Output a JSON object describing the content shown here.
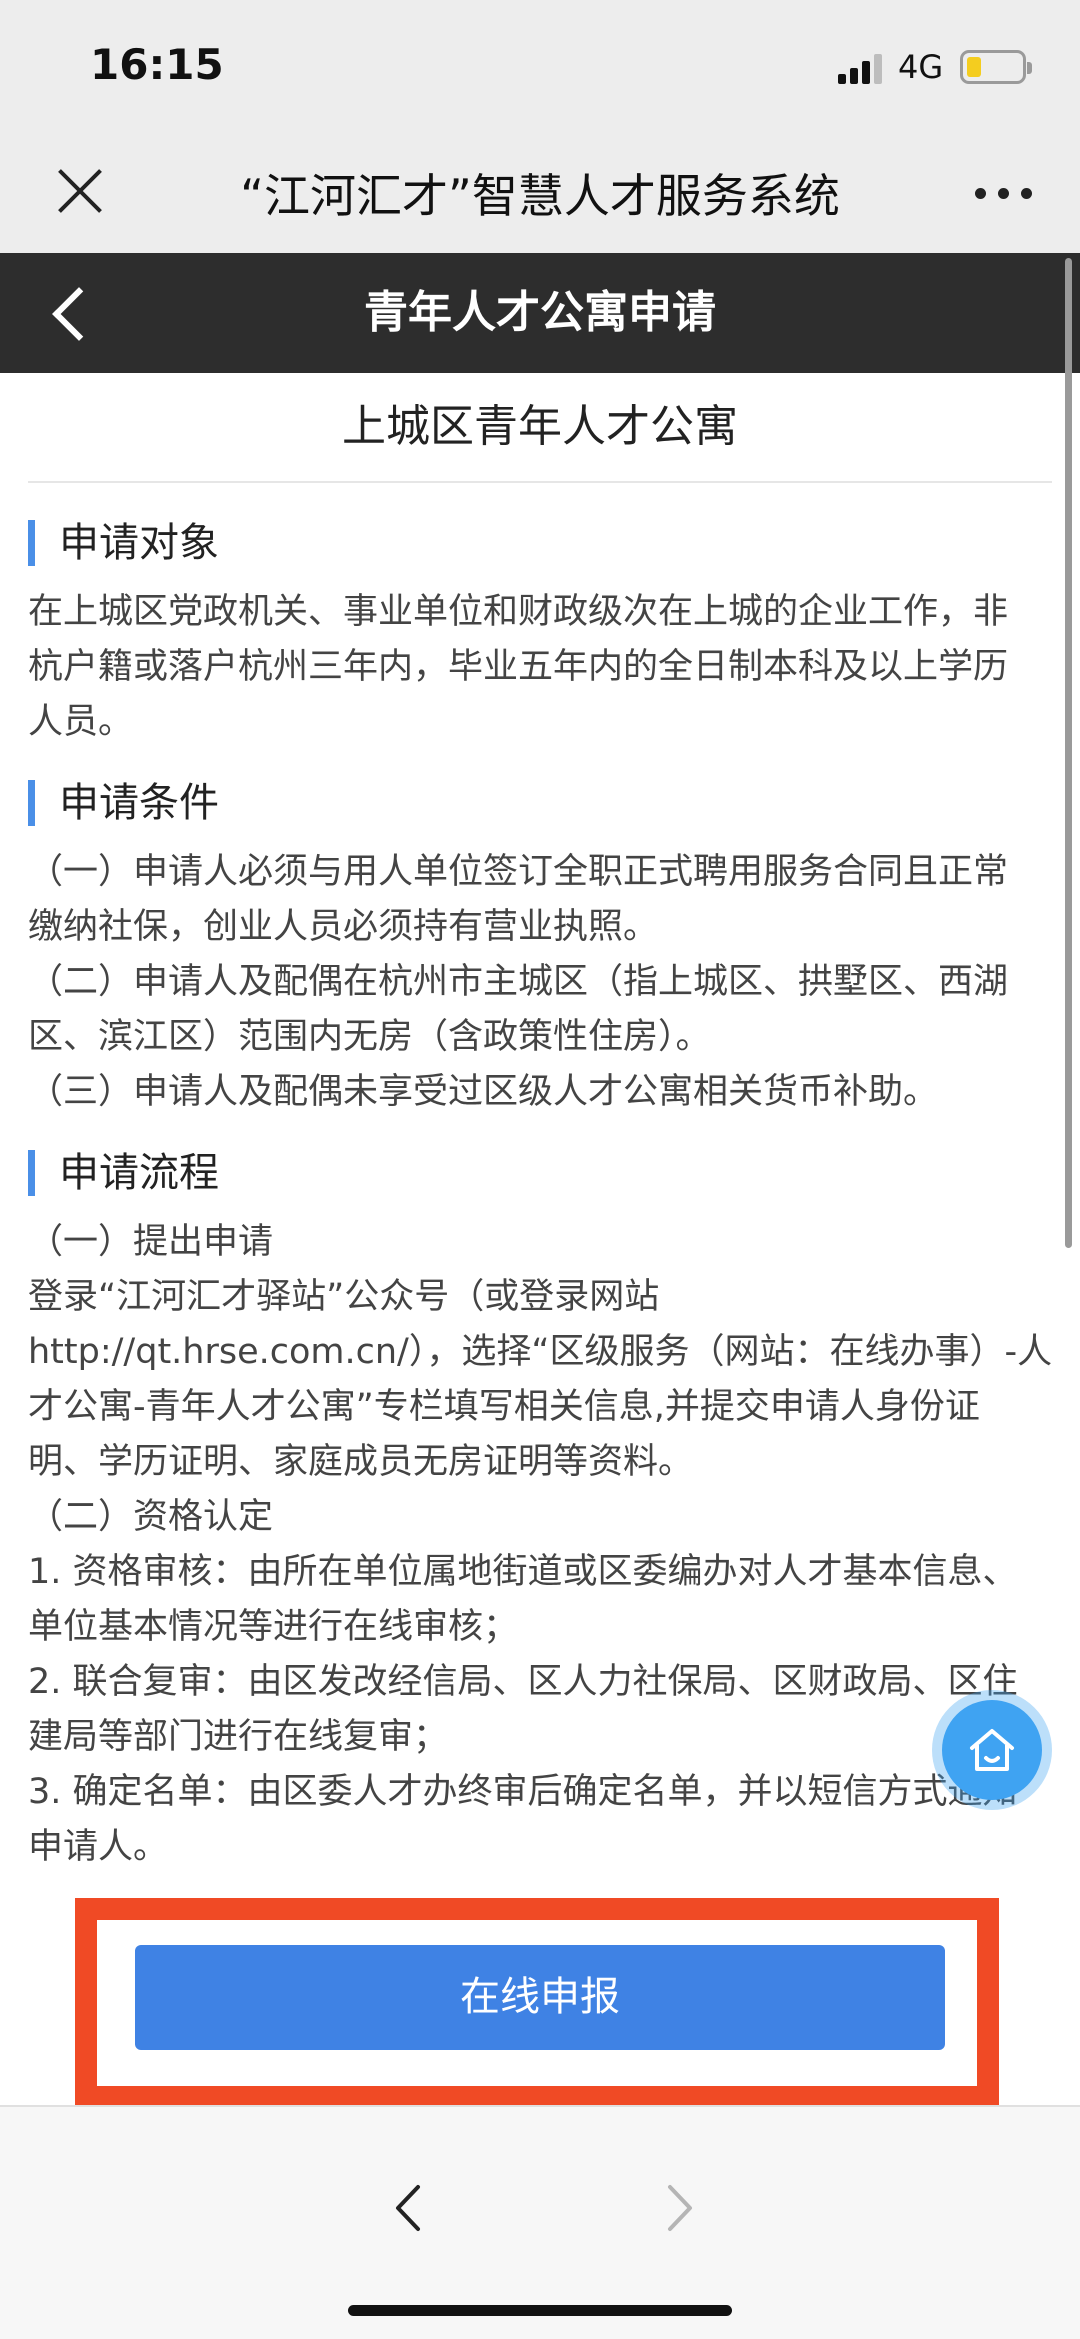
{
  "status": {
    "time": "16:15",
    "network": "4G"
  },
  "header": {
    "title": "“江河汇才”智慧人才服务系统"
  },
  "nav": {
    "title": "青年人才公寓申请"
  },
  "content": {
    "apartment_title": "上城区青年人才公寓",
    "sections": [
      {
        "heading": "申请对象",
        "lines": [
          "在上城区党政机关、事业单位和财政级次在上城的企业工作，非",
          "杭户籍或落户杭州三年内，毕业五年内的全日制本科及以上学历",
          "人员。"
        ]
      },
      {
        "heading": "申请条件",
        "lines": [
          "（一）申请人必须与用人单位签订全职正式聘用服务合同且正常",
          "缴纳社保，创业人员必须持有营业执照。",
          "（二）申请人及配偶在杭州市主城区（指上城区、拱墅区、西湖",
          "区、滨江区）范围内无房（含政策性住房）。",
          "（三）申请人及配偶未享受过区级人才公寓相关货币补助。"
        ]
      },
      {
        "heading": "申请流程",
        "lines": [
          "（一）提出申请",
          "登录“江河汇才驿站”公众号（或登录网站",
          "http://qt.hrse.com.cn/），选择“区级服务（网站：在线办事）-人",
          "才公寓-青年人才公寓”专栏填写相关信息,并提交申请人身份证",
          "明、学历证明、家庭成员无房证明等资料。",
          "（二）资格认定",
          "1. 资格审核：由所在单位属地街道或区委编办对人才基本信息、",
          "单位基本情况等进行在线审核；",
          "2. 联合复审：由区发改经信局、区人力社保局、区财政局、区住",
          "建局等部门进行在线复审；",
          "3. 确定名单：由区委人才办终审后确定名单，并以短信方式通知",
          "申请人。"
        ]
      }
    ]
  },
  "actions": {
    "apply_label": "在线申报"
  },
  "icons": {
    "close": "close-icon",
    "more": "more-icon",
    "back": "chevron-left-icon",
    "home": "home-icon",
    "fwd": "chevron-right-icon"
  },
  "colors": {
    "accent": "#3f82e4",
    "highlight": "#f04a25",
    "section_bar": "#4a8fe7",
    "nav_bg": "#2d2d2d"
  }
}
